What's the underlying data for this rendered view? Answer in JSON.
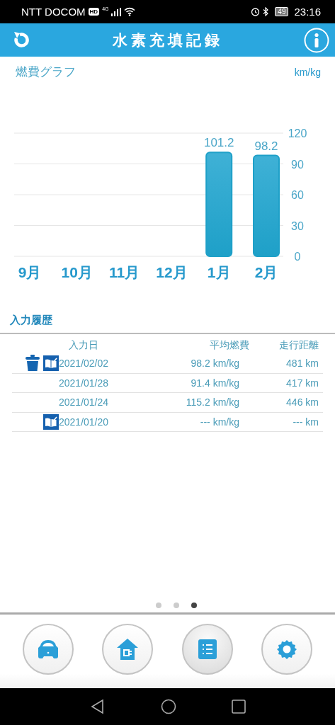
{
  "status_bar": {
    "carrier": "NTT DOCOM",
    "hd_badge": "HD",
    "network": "4G",
    "battery": "49",
    "time": "23:16"
  },
  "header": {
    "title": "水素充填記録"
  },
  "chart_section": {
    "title": "燃費グラフ",
    "unit": "km/kg",
    "chart_data": {
      "type": "bar",
      "categories": [
        "9月",
        "10月",
        "11月",
        "12月",
        "1月",
        "2月"
      ],
      "series": [
        {
          "color": "#1ea0c8",
          "values": [
            null,
            null,
            null,
            null,
            101.2,
            98.2
          ]
        }
      ],
      "ylim": [
        0,
        120
      ],
      "yticks": [
        0,
        30,
        60,
        90,
        120
      ],
      "data_labels": true,
      "grid": true
    }
  },
  "history": {
    "title": "入力履歴",
    "columns": [
      "入力日",
      "平均燃費",
      "走行距離"
    ],
    "rows": [
      {
        "can_delete": true,
        "can_edit": true,
        "date": "2021/02/02",
        "fuel": "98.2 km/kg",
        "distance": "481 km"
      },
      {
        "can_delete": false,
        "can_edit": false,
        "date": "2021/01/28",
        "fuel": "91.4 km/kg",
        "distance": "417 km"
      },
      {
        "can_delete": false,
        "can_edit": false,
        "date": "2021/01/24",
        "fuel": "115.2 km/kg",
        "distance": "446 km"
      },
      {
        "can_delete": false,
        "can_edit": true,
        "date": "2021/01/20",
        "fuel": "--- km/kg",
        "distance": "--- km"
      }
    ]
  },
  "pager": [
    {
      "selected": false
    },
    {
      "selected": false
    },
    {
      "selected": true
    }
  ],
  "bottom_nav": [
    {
      "kind": "car",
      "selected": false
    },
    {
      "kind": "home",
      "selected": false
    },
    {
      "kind": "list",
      "selected": true
    },
    {
      "kind": "settings",
      "selected": false
    }
  ]
}
